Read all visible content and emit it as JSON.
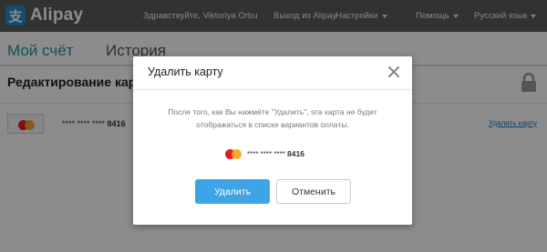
{
  "header": {
    "logo_text": "Alipay",
    "logo_glyph": "支",
    "greeting": "Здравствуйте, Viktoriya Orbu",
    "logout": "Выход из Alipay",
    "settings": "Настройки",
    "help": "Помощь",
    "language": "Русский язык"
  },
  "tabs": {
    "account": "Мой счёт",
    "history": "История"
  },
  "section": {
    "title": "Редактирование карт"
  },
  "card": {
    "masked": "**** **** ****",
    "last4": "8416",
    "delete_link": "Удалить карту",
    "brand_icon": "mastercard-icon"
  },
  "modal": {
    "title": "Удалить карту",
    "message": "После того, как Вы нажмёте \"Удалить\", эта карта не будет отображаться в списке вариантов оплаты.",
    "masked": "**** **** ****",
    "last4": "8416",
    "delete_button": "Удалить",
    "cancel_button": "Отменить"
  },
  "colors": {
    "header_bg": "#5b5b5b",
    "active_tab": "#1a9aa6",
    "primary_button": "#3fa3e8",
    "link": "#1f6fb5"
  }
}
